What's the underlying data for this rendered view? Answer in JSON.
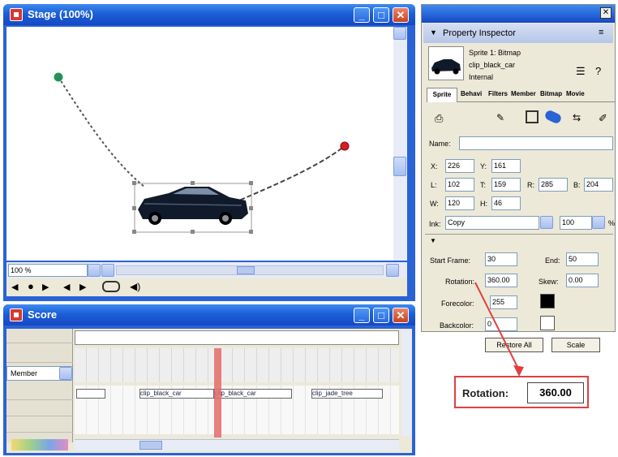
{
  "stage": {
    "title": "Stage (100%)",
    "zoom_value": "100 %"
  },
  "sprite_path": {
    "start_color": "#2e8b57",
    "end_color": "#d42020"
  },
  "score": {
    "title": "Score",
    "member_label": "Member",
    "cells": [
      "clip_black_car",
      "clip_black_car",
      "clip_jade_tree"
    ]
  },
  "inspector": {
    "title": "Property Inspector",
    "sprite_info": [
      "Sprite 1: Bitmap",
      "clip_black_car",
      "Internal"
    ],
    "tabs": [
      "Sprite",
      "Behavi",
      "Filters",
      "Member",
      "Bitmap",
      "Movie"
    ],
    "name_label": "Name:",
    "x_label": "X:",
    "x_value": "226",
    "y_label": "Y:",
    "y_value": "161",
    "l_label": "L:",
    "l_value": "102",
    "t_label": "T:",
    "t_value": "159",
    "r_label": "R:",
    "r_value": "285",
    "b_label": "B:",
    "b_value": "204",
    "w_label": "W:",
    "w_value": "120",
    "h_label": "H:",
    "h_value": "46",
    "ink_label": "Ink:",
    "ink_value": "Copy",
    "blend_value": "100",
    "blend_unit": "%",
    "start_frame_label": "Start Frame:",
    "start_frame_value": "30",
    "end_label": "End:",
    "end_value": "50",
    "rotation_label": "Rotation:",
    "rotation_value": "360.00",
    "skew_label": "Skew:",
    "skew_value": "0.00",
    "forecolor_label": "Forecolor:",
    "forecolor_value": "255",
    "backcolor_label": "Backcolor:",
    "backcolor_value": "0",
    "restore_all_label": "Restore All",
    "scale_label": "Scale"
  },
  "callout": {
    "label": "Rotation:",
    "value": "360.00",
    "border_color": "#e04040"
  }
}
